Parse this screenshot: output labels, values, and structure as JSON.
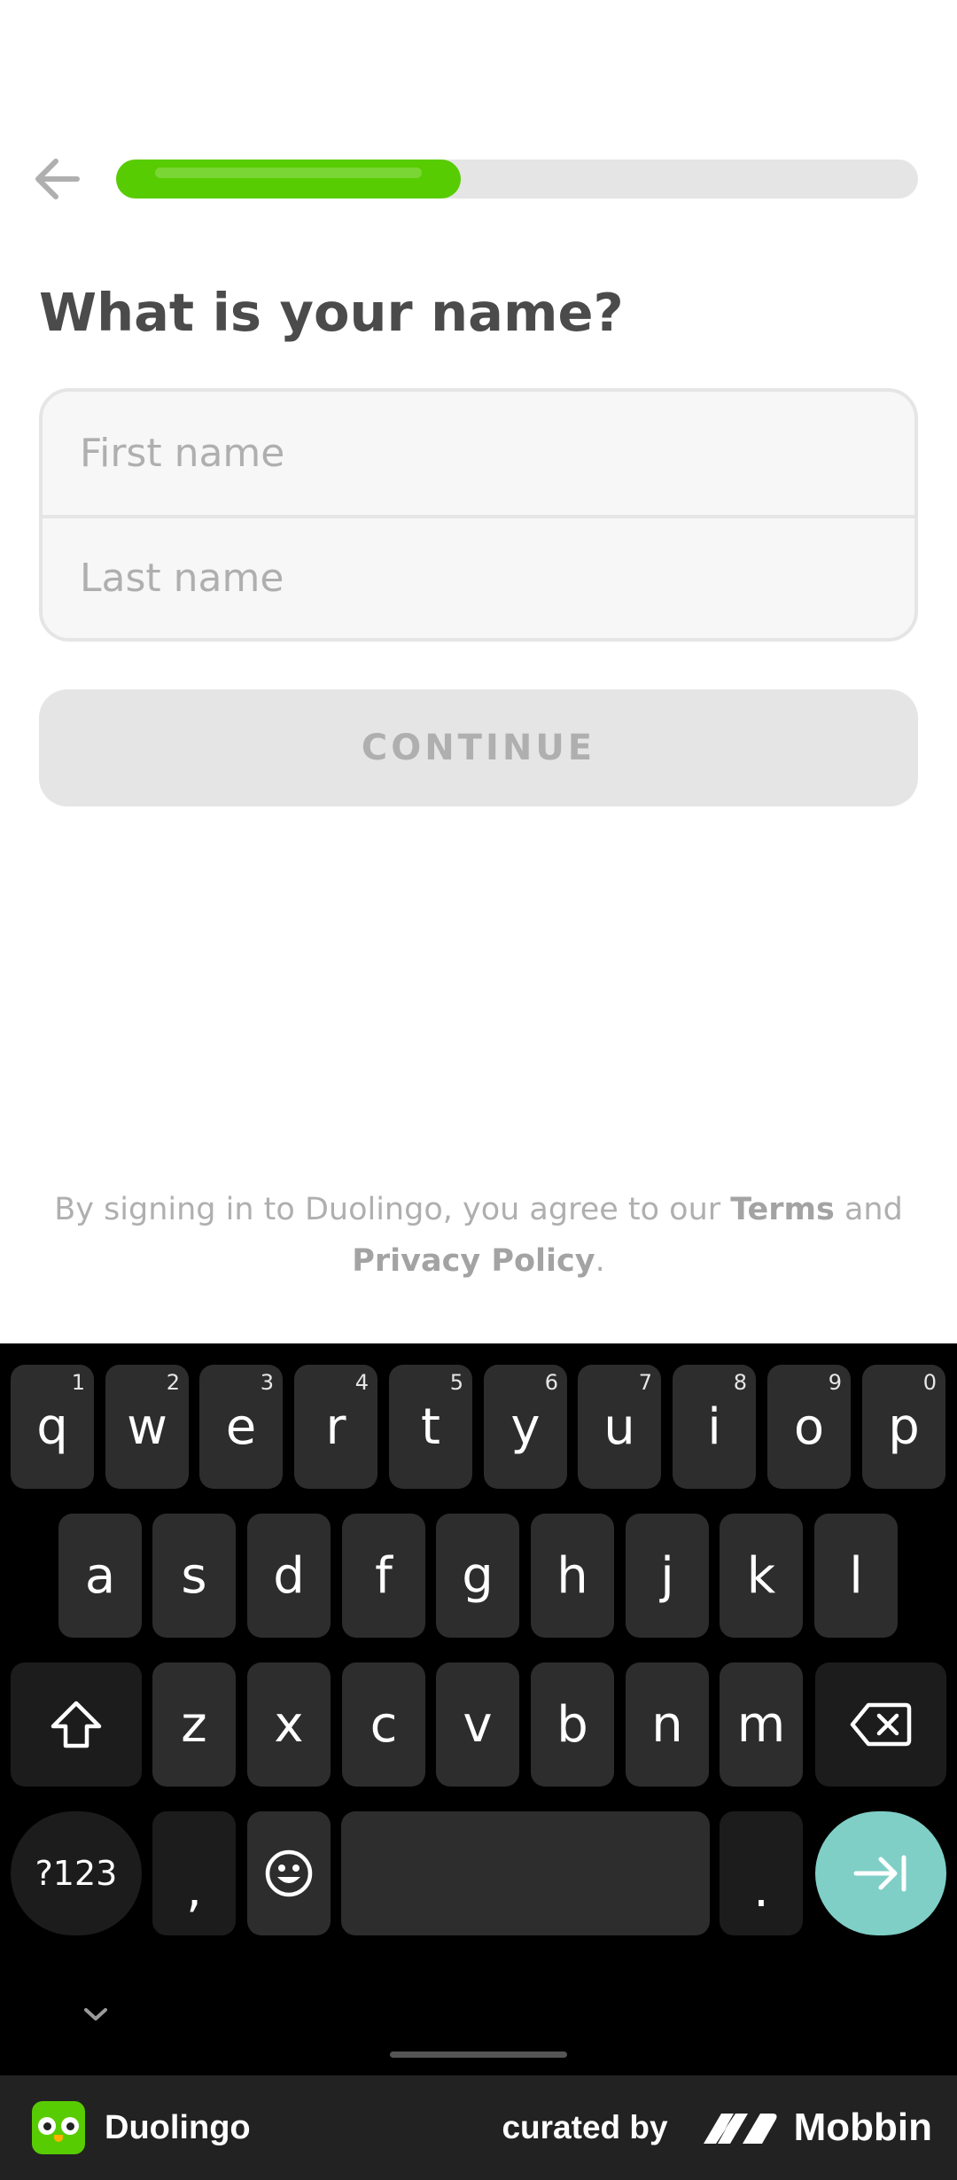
{
  "app": {
    "back_icon": "arrow-left-icon",
    "progress": 0.43,
    "progress_color": "#58cc02",
    "question": "What is your name?",
    "first_name": {
      "placeholder": "First name",
      "value": ""
    },
    "last_name": {
      "placeholder": "Last name",
      "value": ""
    },
    "continue_label": "CONTINUE",
    "legal": {
      "prefix": "By signing in to Duolingo, you agree to our ",
      "terms": "Terms",
      "and": " and",
      "privacy": "Privacy Policy",
      "suffix": "."
    }
  },
  "keyboard": {
    "row1": [
      {
        "key": "q",
        "hint": "1"
      },
      {
        "key": "w",
        "hint": "2"
      },
      {
        "key": "e",
        "hint": "3"
      },
      {
        "key": "r",
        "hint": "4"
      },
      {
        "key": "t",
        "hint": "5"
      },
      {
        "key": "y",
        "hint": "6"
      },
      {
        "key": "u",
        "hint": "7"
      },
      {
        "key": "i",
        "hint": "8"
      },
      {
        "key": "o",
        "hint": "9"
      },
      {
        "key": "p",
        "hint": "0"
      }
    ],
    "row2": [
      "a",
      "s",
      "d",
      "f",
      "g",
      "h",
      "j",
      "k",
      "l"
    ],
    "row3": [
      "z",
      "x",
      "c",
      "v",
      "b",
      "n",
      "m"
    ],
    "shift_icon": "shift-icon",
    "backspace_icon": "backspace-icon",
    "symbols_label": "?123",
    "comma": ",",
    "emoji_icon": "emoji-icon",
    "period": ".",
    "enter_icon": "next-field-icon",
    "collapse_icon": "chevron-down-icon"
  },
  "footer": {
    "app_name": "Duolingo",
    "curated_by": "curated by",
    "brand": "Mobbin"
  }
}
